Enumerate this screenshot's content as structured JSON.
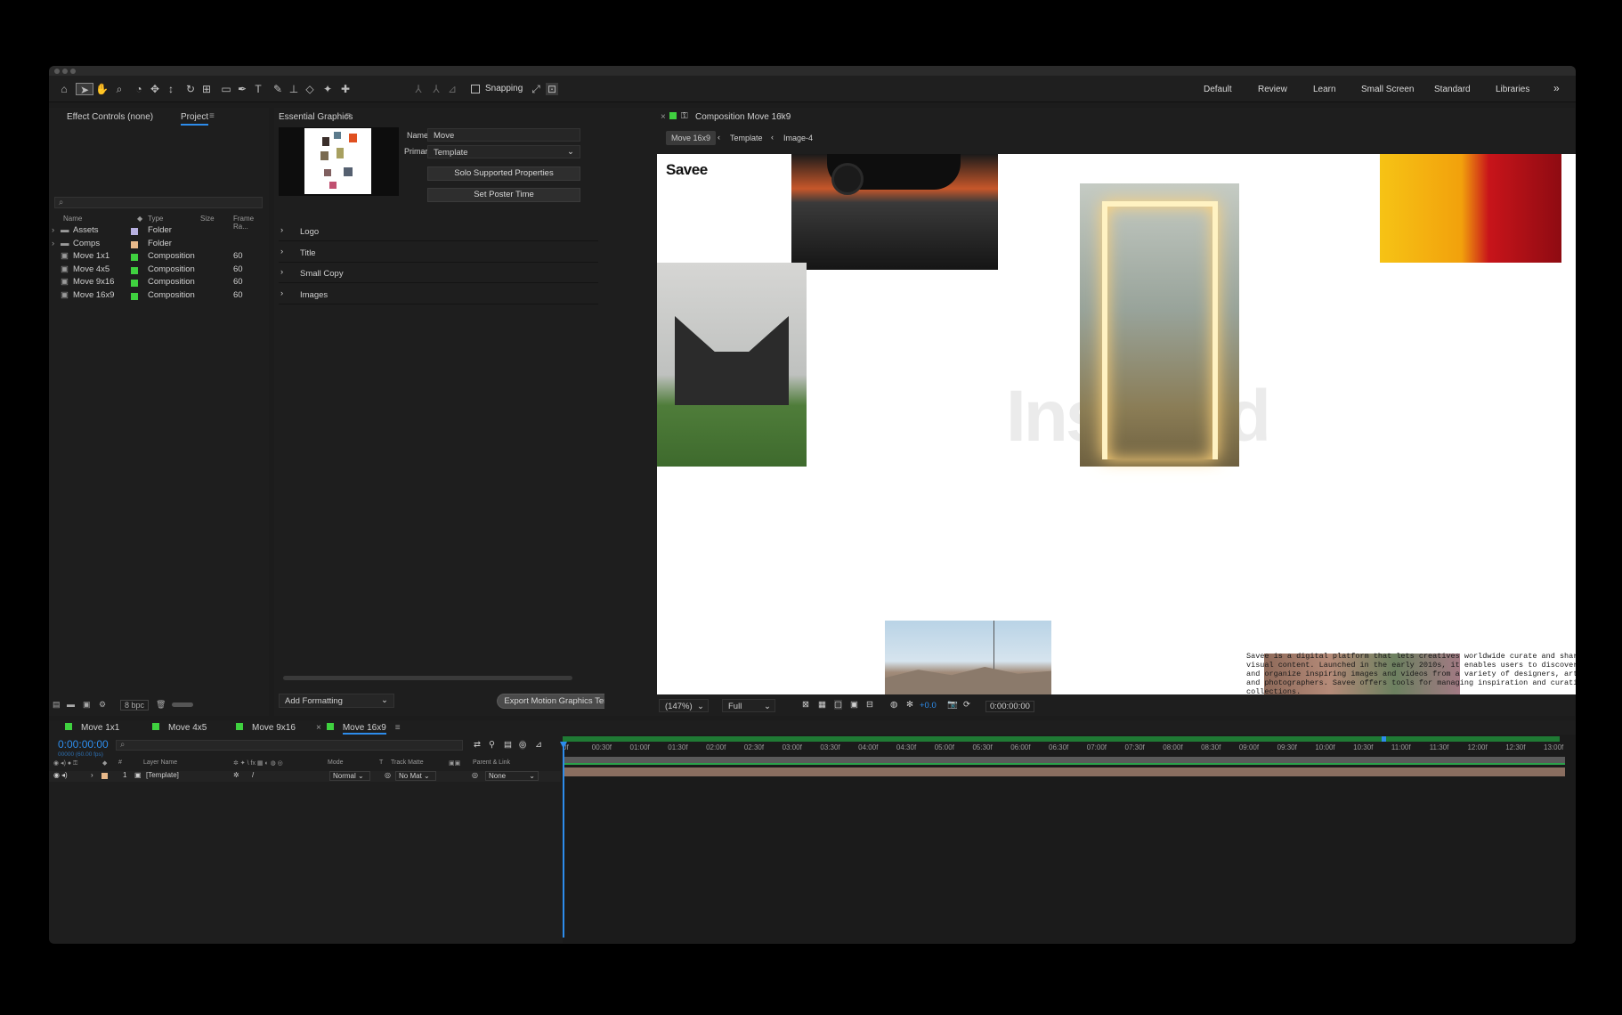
{
  "toolbar": {
    "snapping_label": "Snapping",
    "workspaces": [
      "Default",
      "Review",
      "Learn",
      "Small Screen",
      "Standard",
      "Libraries"
    ],
    "more_icon": "double-chevron-right-icon"
  },
  "project_panel": {
    "tab_effect_controls": "Effect Controls (none)",
    "tab_project": "Project",
    "columns": {
      "name": "Name",
      "type": "Type",
      "size": "Size",
      "frame_rate": "Frame Ra..."
    },
    "items": [
      {
        "name": "Assets",
        "type": "Folder",
        "fps": "",
        "kind": "folder",
        "color": "#b7b0e0"
      },
      {
        "name": "Comps",
        "type": "Folder",
        "fps": "",
        "kind": "folder",
        "color": "#e8b98a"
      },
      {
        "name": "Move 1x1",
        "type": "Composition",
        "fps": "60",
        "kind": "comp",
        "color": "#3fd13f"
      },
      {
        "name": "Move 4x5",
        "type": "Composition",
        "fps": "60",
        "kind": "comp",
        "color": "#3fd13f"
      },
      {
        "name": "Move 9x16",
        "type": "Composition",
        "fps": "60",
        "kind": "comp",
        "color": "#3fd13f"
      },
      {
        "name": "Move 16x9",
        "type": "Composition",
        "fps": "60",
        "kind": "comp",
        "color": "#3fd13f"
      }
    ],
    "bpc": "8 bpc"
  },
  "essential_graphics": {
    "title": "Essential Graphics",
    "name_label": "Name:",
    "name_value": "Move",
    "primary_label": "Primary:",
    "primary_value": "Template",
    "solo_button": "Solo Supported Properties",
    "poster_button": "Set Poster Time",
    "properties": [
      "Logo",
      "Title",
      "Small Copy",
      "Images"
    ],
    "add_formatting": "Add Formatting",
    "export_button": "Export Motion Graphics Template..."
  },
  "composition": {
    "tab_title": "Composition Move 16x9",
    "breadcrumbs": [
      "Move 16x9",
      "Template",
      "Image-4"
    ],
    "logo_text": "Savee",
    "headline_text": "Inspired",
    "body_text": "Savee is a digital platform that lets creatives worldwide curate and share visual content. Launched in the early 2010s, it enables users to discover, save, and organize inspiring images and videos from a variety of designers, artists, and photographers. Savee offers tools for managing inspiration and curating collections.",
    "zoom": "(147%)",
    "resolution": "Full",
    "exposure": "+0.0",
    "timecode": "0:00:00:00"
  },
  "timeline": {
    "tabs": [
      "Move 1x1",
      "Move 4x5",
      "Move 9x16",
      "Move 16x9"
    ],
    "timecode": "0:00:00:00",
    "fps_info": "00000 (60.00 fps)",
    "headers": {
      "layer_name": "Layer Name",
      "mode": "Mode",
      "t": "T",
      "track_matte": "Track Matte",
      "parent": "Parent & Link"
    },
    "layer": {
      "index": "1",
      "name": "[Template]",
      "mode": "Normal",
      "matte": "No Mat",
      "parent": "None"
    },
    "ruler": [
      "0f",
      "00:30f",
      "01:00f",
      "01:30f",
      "02:00f",
      "02:30f",
      "03:00f",
      "03:30f",
      "04:00f",
      "04:30f",
      "05:00f",
      "05:30f",
      "06:00f",
      "06:30f",
      "07:00f",
      "07:30f",
      "08:00f",
      "08:30f",
      "09:00f",
      "09:30f",
      "10:00f",
      "10:30f",
      "11:00f",
      "11:30f",
      "12:00f",
      "12:30f",
      "13:00f"
    ]
  },
  "colors": {
    "accent": "#2d8ceb",
    "label_green": "#3fd13f",
    "layer_bar": "#8a6e60",
    "workarea": "#1f7a34"
  }
}
